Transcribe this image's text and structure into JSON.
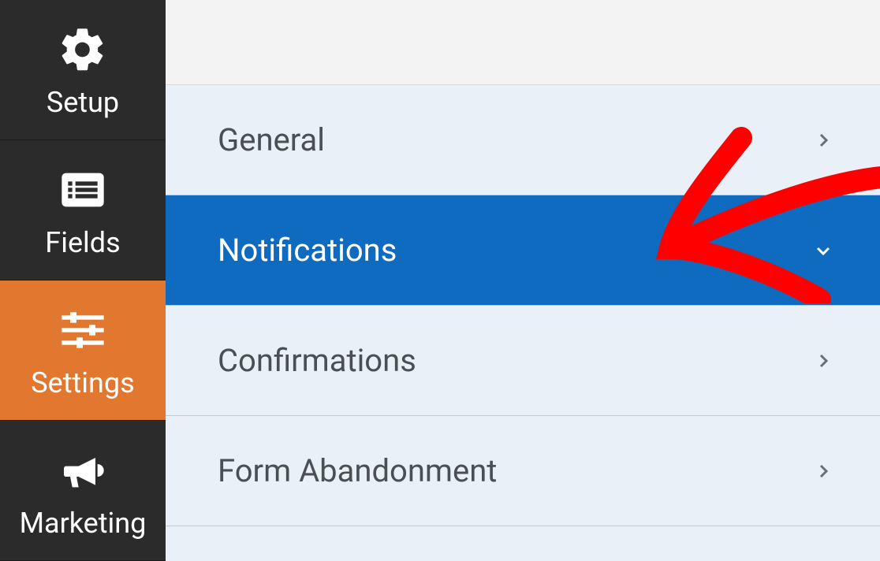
{
  "sidebar": {
    "items": [
      {
        "label": "Setup",
        "icon": "gear-icon",
        "active": false
      },
      {
        "label": "Fields",
        "icon": "list-icon",
        "active": false
      },
      {
        "label": "Settings",
        "icon": "sliders-icon",
        "active": true
      },
      {
        "label": "Marketing",
        "icon": "bullhorn-icon",
        "active": false
      }
    ]
  },
  "settings": {
    "rows": [
      {
        "label": "General",
        "active": false
      },
      {
        "label": "Notifications",
        "active": true
      },
      {
        "label": "Confirmations",
        "active": false
      },
      {
        "label": "Form Abandonment",
        "active": false
      }
    ]
  },
  "colors": {
    "sidebar_bg": "#2b2b2b",
    "sidebar_active": "#e27730",
    "row_active": "#0f6bbf",
    "panel_bg": "#e9f0f7",
    "annotation": "#ff0000"
  }
}
